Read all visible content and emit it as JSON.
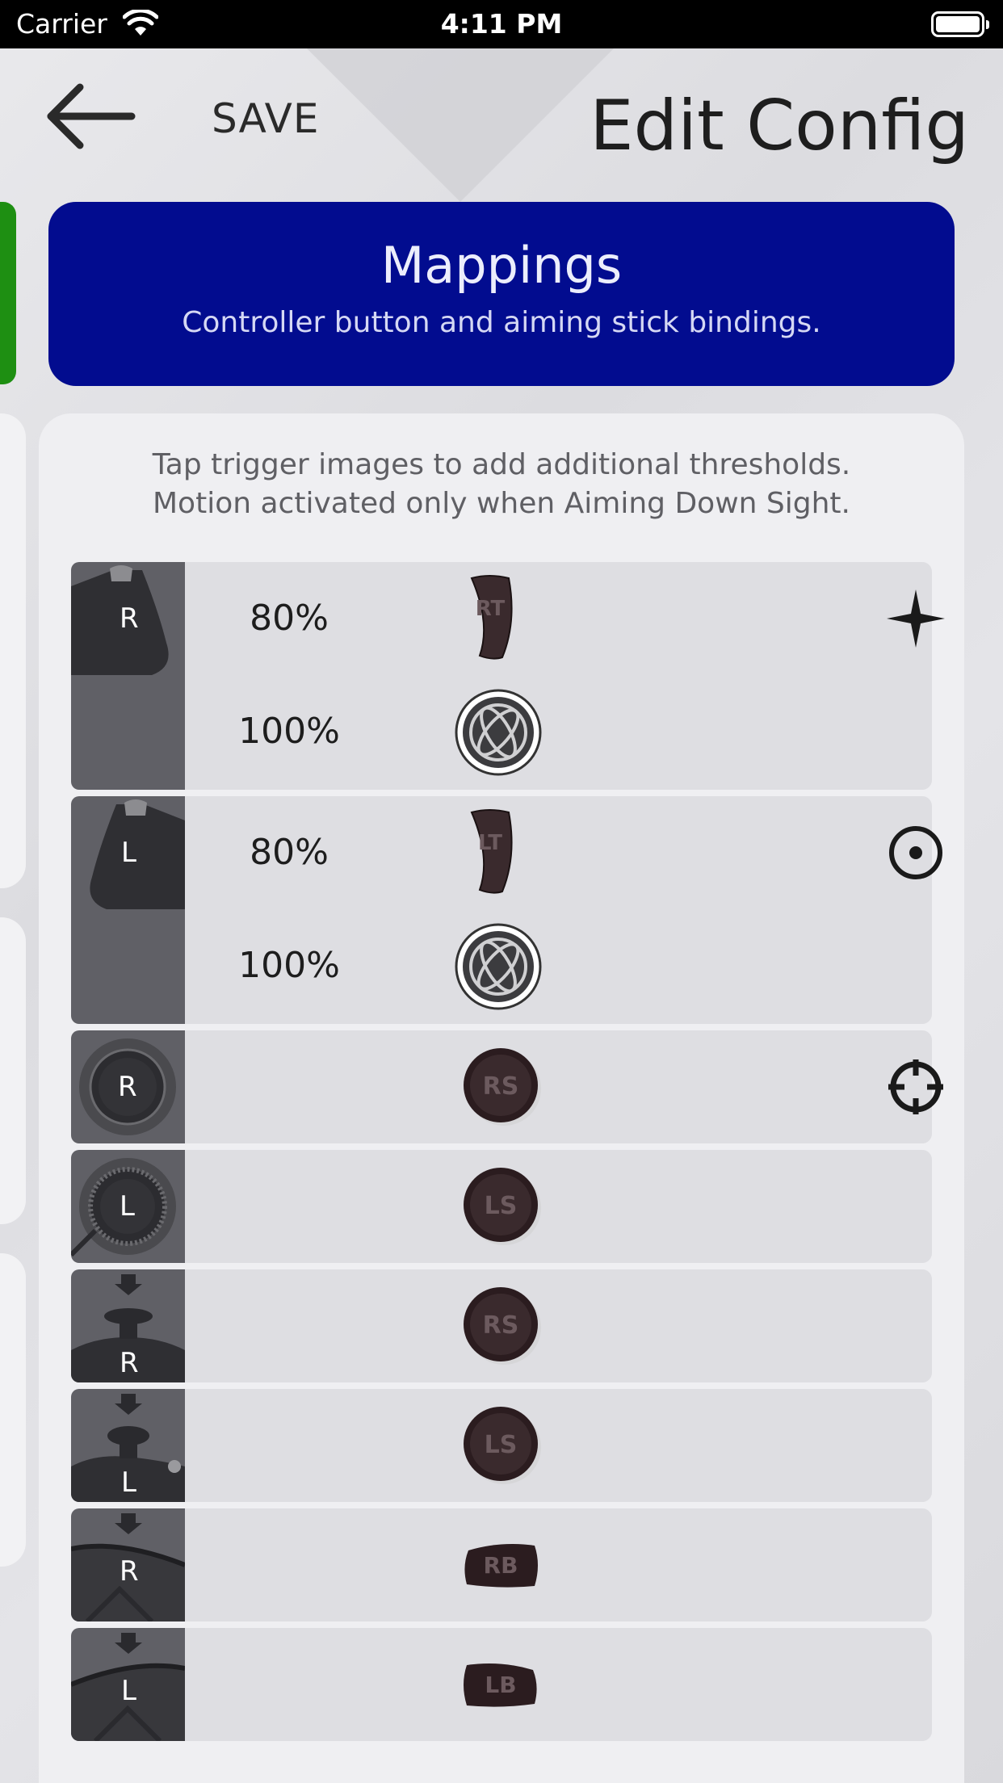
{
  "status_bar": {
    "carrier": "Carrier",
    "time": "4:11 PM"
  },
  "header": {
    "save_label": "SAVE",
    "title": "Edit Config"
  },
  "section": {
    "title": "Mappings",
    "subtitle": "Controller button and aiming stick bindings."
  },
  "instructions": {
    "line1": "Tap trigger images to add additional thresholds.",
    "line2": "Motion activated only when Aiming Down Sight."
  },
  "colors": {
    "section_bg": "#020c8f",
    "accent_green": "#1e8f12",
    "thumb_bg": "#606066",
    "row_bg": "#dedee2"
  },
  "rows": [
    {
      "control": "right-trigger",
      "thumb_label": "R",
      "thresholds": [
        {
          "percent": "80%",
          "button_label": "RT",
          "action_icon": "sparkle-icon"
        },
        {
          "percent": "100%",
          "button_label": "",
          "button_icon": "gyro-icon"
        }
      ]
    },
    {
      "control": "left-trigger",
      "thumb_label": "L",
      "thresholds": [
        {
          "percent": "80%",
          "button_label": "LT",
          "action_icon": "target-dot-icon"
        },
        {
          "percent": "100%",
          "button_label": "",
          "button_icon": "gyro-icon"
        }
      ]
    },
    {
      "control": "right-stick",
      "thumb_label": "R",
      "button_label": "RS",
      "action_icon": "crosshair-icon"
    },
    {
      "control": "left-stick",
      "thumb_label": "L",
      "button_label": "LS"
    },
    {
      "control": "right-stick-click",
      "thumb_label": "R",
      "button_label": "RS"
    },
    {
      "control": "left-stick-click",
      "thumb_label": "L",
      "button_label": "LS"
    },
    {
      "control": "right-back-paddle",
      "thumb_label": "R",
      "button_label": "RB"
    },
    {
      "control": "left-back-paddle",
      "thumb_label": "L",
      "button_label": "LB"
    }
  ]
}
